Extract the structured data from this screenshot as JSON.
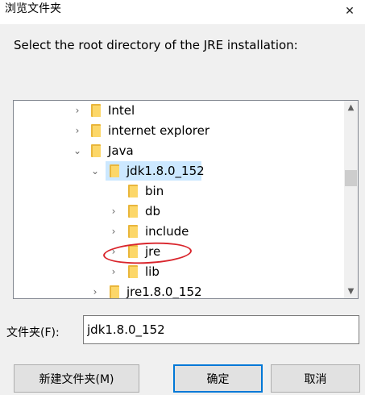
{
  "window": {
    "title": "浏览文件夹",
    "close_icon": "close-icon"
  },
  "prompt": "Select the root directory of the JRE installation:",
  "tree": {
    "items": [
      {
        "label": "Intel",
        "expander": "collapsed"
      },
      {
        "label": "internet explorer",
        "expander": "collapsed"
      },
      {
        "label": "Java",
        "expander": "expanded"
      },
      {
        "label": "jdk1.8.0_152",
        "expander": "expanded",
        "selected": true
      },
      {
        "label": "bin",
        "expander": "none"
      },
      {
        "label": "db",
        "expander": "collapsed"
      },
      {
        "label": "include",
        "expander": "collapsed"
      },
      {
        "label": "jre",
        "expander": "collapsed",
        "highlighted": true
      },
      {
        "label": "lib",
        "expander": "collapsed"
      },
      {
        "label": "jre1.8.0_152",
        "expander": "collapsed"
      }
    ],
    "selection_color": "#cce8ff",
    "annotation_color": "#d9252c"
  },
  "folder_field": {
    "label": "文件夹(F):",
    "value": "jdk1.8.0_152"
  },
  "buttons": {
    "new_folder": "新建文件夹(M)",
    "ok": "确定",
    "cancel": "取消"
  },
  "colors": {
    "accent": "#0078d7",
    "folder": "#fcd769"
  }
}
